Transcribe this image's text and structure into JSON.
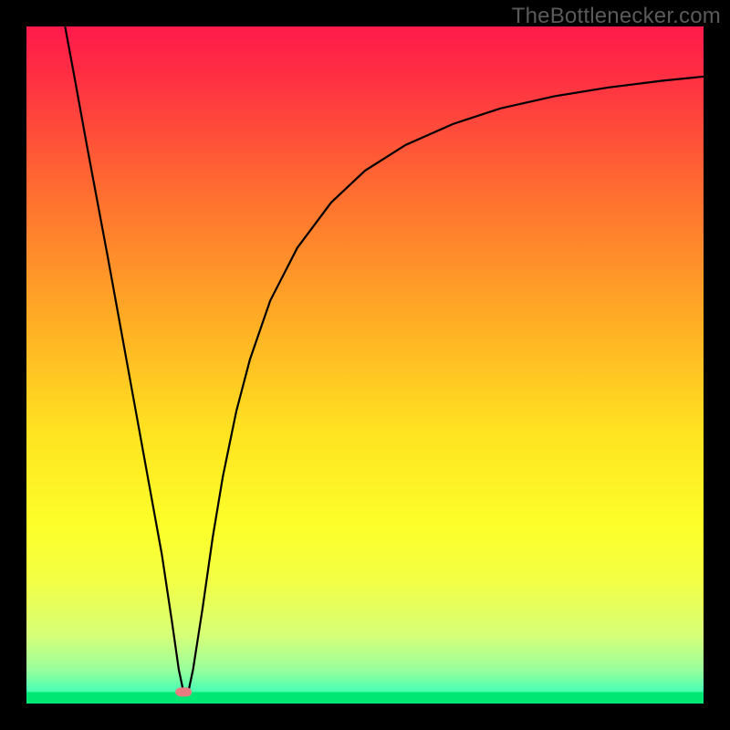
{
  "watermark": "TheBottlenecker.com",
  "chart_data": {
    "type": "line",
    "title": "",
    "xlabel": "",
    "ylabel": "",
    "xlim": [
      0,
      100
    ],
    "ylim": [
      0,
      100
    ],
    "gradient_stops": [
      {
        "offset": 0.0,
        "color": "#ff1a4b"
      },
      {
        "offset": 0.07,
        "color": "#ff2e43"
      },
      {
        "offset": 0.25,
        "color": "#ff6f30"
      },
      {
        "offset": 0.45,
        "color": "#ffb224"
      },
      {
        "offset": 0.6,
        "color": "#ffe321"
      },
      {
        "offset": 0.74,
        "color": "#fcff2a"
      },
      {
        "offset": 0.82,
        "color": "#f2ff45"
      },
      {
        "offset": 0.9,
        "color": "#d6ff78"
      },
      {
        "offset": 0.95,
        "color": "#99ff9c"
      },
      {
        "offset": 0.98,
        "color": "#4dffb2"
      },
      {
        "offset": 1.0,
        "color": "#00ff88"
      }
    ],
    "bottom_band": {
      "y": 1.7,
      "color": "#00E874"
    },
    "marker": {
      "x": 23.2,
      "y": 1.7,
      "color": "#E87C80"
    },
    "series": [
      {
        "name": "curve",
        "points": [
          {
            "x": 5.7,
            "y": 100.0
          },
          {
            "x": 7.0,
            "y": 93.0
          },
          {
            "x": 9.0,
            "y": 82.0
          },
          {
            "x": 12.0,
            "y": 66.0
          },
          {
            "x": 15.0,
            "y": 49.5
          },
          {
            "x": 18.0,
            "y": 33.0
          },
          {
            "x": 20.0,
            "y": 22.0
          },
          {
            "x": 21.5,
            "y": 12.0
          },
          {
            "x": 22.5,
            "y": 5.0
          },
          {
            "x": 23.2,
            "y": 1.7
          },
          {
            "x": 23.9,
            "y": 1.7
          },
          {
            "x": 24.6,
            "y": 5.0
          },
          {
            "x": 26.0,
            "y": 14.0
          },
          {
            "x": 27.5,
            "y": 24.5
          },
          {
            "x": 29.0,
            "y": 33.5
          },
          {
            "x": 31.0,
            "y": 43.2
          },
          {
            "x": 33.0,
            "y": 50.8
          },
          {
            "x": 36.0,
            "y": 59.5
          },
          {
            "x": 40.0,
            "y": 67.3
          },
          {
            "x": 45.0,
            "y": 74.0
          },
          {
            "x": 50.0,
            "y": 78.7
          },
          {
            "x": 56.0,
            "y": 82.5
          },
          {
            "x": 63.0,
            "y": 85.6
          },
          {
            "x": 70.0,
            "y": 87.9
          },
          {
            "x": 78.0,
            "y": 89.7
          },
          {
            "x": 86.0,
            "y": 91.0
          },
          {
            "x": 94.0,
            "y": 92.0
          },
          {
            "x": 100.0,
            "y": 92.6
          }
        ]
      }
    ]
  }
}
